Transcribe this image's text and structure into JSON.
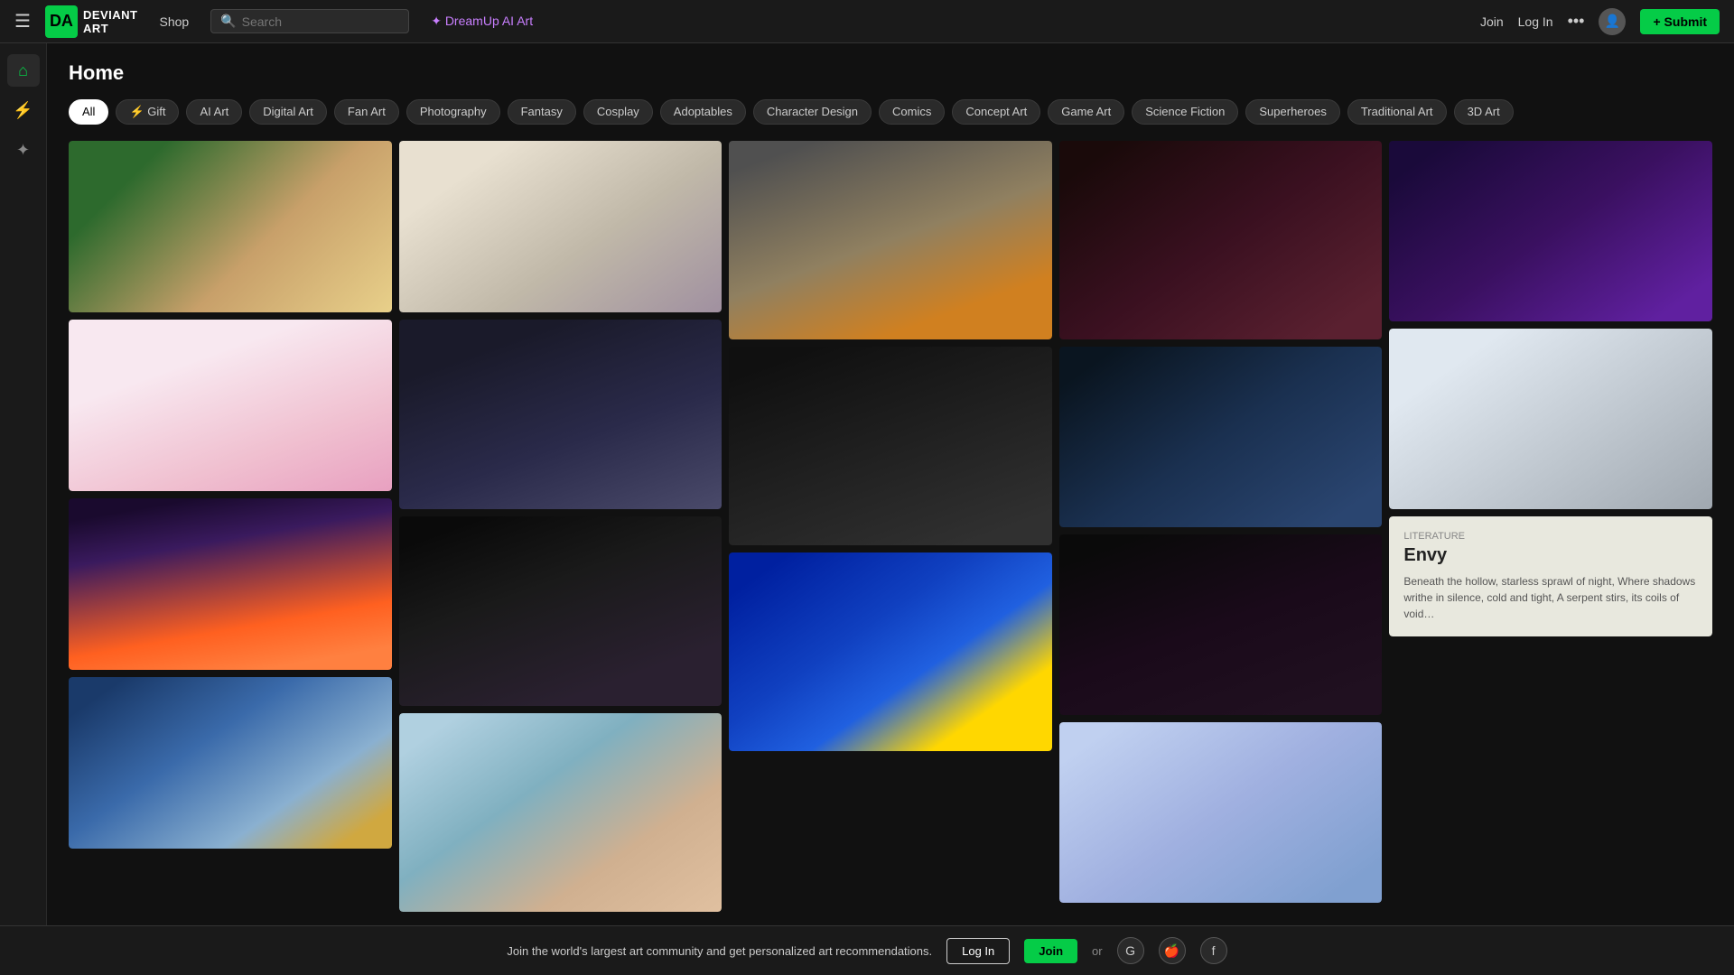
{
  "nav": {
    "hamburger": "☰",
    "logo_text": "DEVIANT ART",
    "shop_label": "Shop",
    "search_placeholder": "Search",
    "dreamup_label": "✦ DreamUp AI Art",
    "join_label": "+ Submit",
    "login_label": "Log In",
    "more_label": "•••",
    "join_main": "Join"
  },
  "sidebar": {
    "home_icon": "⌂",
    "lightning_icon": "⚡",
    "sparkle_icon": "✦"
  },
  "page": {
    "title": "Home"
  },
  "categories": [
    {
      "label": "All",
      "active": true
    },
    {
      "label": "Gift",
      "icon": "⚡"
    },
    {
      "label": "AI Art"
    },
    {
      "label": "Digital Art"
    },
    {
      "label": "Fan Art"
    },
    {
      "label": "Photography"
    },
    {
      "label": "Fantasy"
    },
    {
      "label": "Cosplay"
    },
    {
      "label": "Adoptables"
    },
    {
      "label": "Character Design"
    },
    {
      "label": "Comics"
    },
    {
      "label": "Concept Art"
    },
    {
      "label": "Game Art"
    },
    {
      "label": "Science Fiction"
    },
    {
      "label": "Superheroes"
    },
    {
      "label": "Traditional Art"
    },
    {
      "label": "3D Art"
    }
  ],
  "literature_card": {
    "label": "Literature",
    "title": "Envy",
    "text": "Beneath the hollow, starless sprawl of night, Where shadows writhe in silence, cold and tight, A serpent stirs, its coils of void…"
  },
  "banner": {
    "text": "Join the world's largest art community and get personalized art recommendations.",
    "login_label": "Log In",
    "join_label": "Join",
    "or_label": "or"
  }
}
